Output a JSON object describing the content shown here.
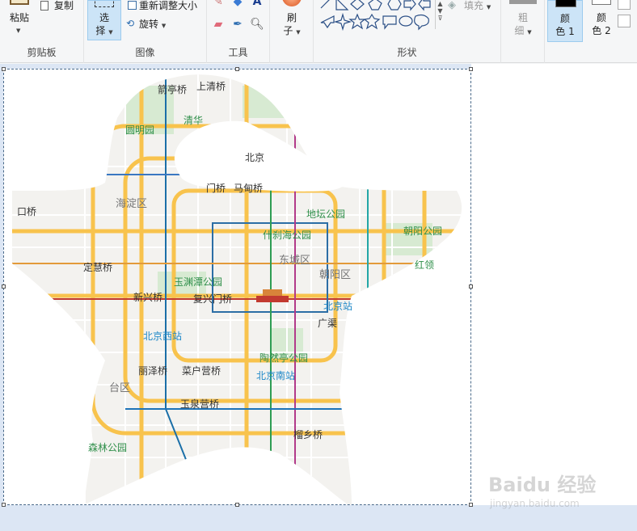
{
  "ribbon": {
    "clipboard": {
      "group_label": "剪贴板",
      "paste_label": "粘贴",
      "copy_label": "复制"
    },
    "image": {
      "group_label": "图像",
      "select_l1": "选",
      "select_l2": "择",
      "resize_label": "重新调整大小",
      "rotate_label": "旋转"
    },
    "tools": {
      "group_label": "工具"
    },
    "brushes": {
      "label_l1": "刷",
      "label_l2": "子"
    },
    "shapes": {
      "group_label": "形状",
      "fill_label": "填充"
    },
    "size": {
      "label_l1": "粗",
      "label_l2": "细"
    },
    "colors": {
      "color1_l1": "颜",
      "color1_l2": "色 1",
      "color2_l1": "颜",
      "color2_l2": "色 2",
      "color1": "#000000",
      "color2": "#ffffff"
    }
  },
  "map": {
    "labels": {
      "jianting": "箭亭桥",
      "shangqing": "上清桥",
      "yuanmingyuan": "圆明园",
      "qinghua": "清华",
      "beijing_u": "北京",
      "haidian": "海淀区",
      "kou": "口桥",
      "ximen": "门桥",
      "madian": "马甸桥",
      "ditan": "地坛公园",
      "shichahai": "什刹海公园",
      "chaoyang_park": "朝阳公园",
      "dingcheng": "东城区",
      "chaoyang": "朝阳区",
      "honglin": "红领",
      "dinghui": "定慧桥",
      "yuyuantan": "玉渊潭公园",
      "xinxing": "新兴桥",
      "fuxingmen": "复兴门桥",
      "beijing_station": "北京站",
      "guangqu": "广渠",
      "beijing_west": "北京西站",
      "taoranting": "陶然亭公园",
      "lize": "丽泽桥",
      "caihuying": "菜户营桥",
      "beijing_south": "北京南站",
      "taiqu": "台区",
      "yuquanying": "玉泉营桥",
      "senlin": "森林公园",
      "liuxiang": "榴乡桥"
    }
  },
  "watermark": {
    "logo": "Baidu 经验",
    "url": "jingyan.baidu.com"
  }
}
